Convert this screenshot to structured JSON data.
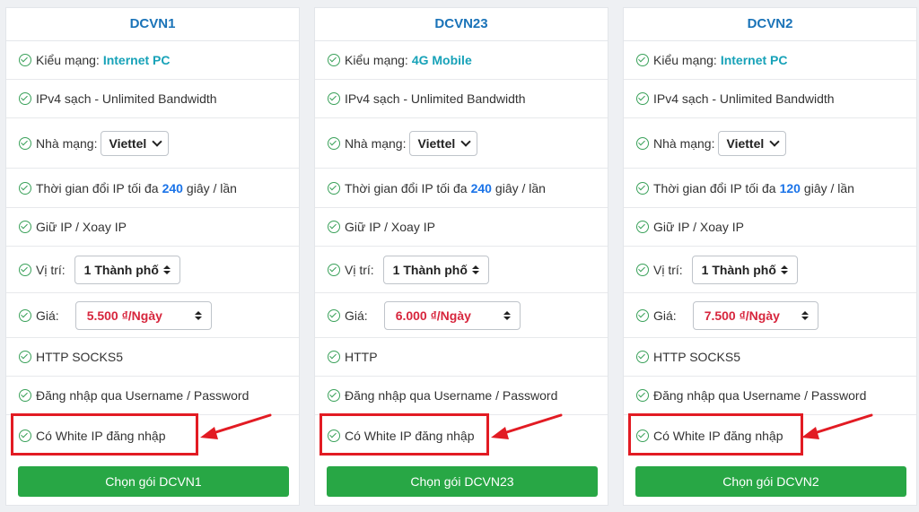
{
  "accent": {
    "green": "#28a745",
    "red_highlight": "#e21b23",
    "title_blue": "#1a73b8"
  },
  "icons": {
    "check": "check-circle-icon",
    "arrow": "red-arrow-annotation"
  },
  "plans": [
    {
      "title": "DCVN1",
      "network_label": "Kiểu mạng:",
      "network_value": "Internet PC",
      "ipv4": "IPv4 sạch - Unlimited Bandwidth",
      "isp_label": "Nhà mạng:",
      "isp_value": "Viettel",
      "rotate_prefix": "Thời gian đổi IP tối đa",
      "rotate_seconds": "240",
      "rotate_suffix": "giây / lần",
      "keep_ip": "Giữ IP / Xoay IP",
      "location_label": "Vị trí:",
      "location_value": "1 Thành phố",
      "price_label": "Giá:",
      "price_value": "5.500 ₫/Ngày",
      "protocols": "HTTP SOCKS5",
      "login": "Đăng nhập qua Username / Password",
      "whitelist": "Có White IP đăng nhập",
      "button": "Chọn gói DCVN1"
    },
    {
      "title": "DCVN23",
      "network_label": "Kiểu mạng:",
      "network_value": "4G Mobile",
      "ipv4": "IPv4 sạch - Unlimited Bandwidth",
      "isp_label": "Nhà mạng:",
      "isp_value": "Viettel",
      "rotate_prefix": "Thời gian đổi IP tối đa",
      "rotate_seconds": "240",
      "rotate_suffix": "giây / lần",
      "keep_ip": "Giữ IP / Xoay IP",
      "location_label": "Vị trí:",
      "location_value": "1 Thành phố",
      "price_label": "Giá:",
      "price_value": "6.000 ₫/Ngày",
      "protocols": "HTTP",
      "login": "Đăng nhập qua Username / Password",
      "whitelist": "Có White IP đăng nhập",
      "button": "Chọn gói DCVN23"
    },
    {
      "title": "DCVN2",
      "network_label": "Kiểu mạng:",
      "network_value": "Internet PC",
      "ipv4": "IPv4 sạch - Unlimited Bandwidth",
      "isp_label": "Nhà mạng:",
      "isp_value": "Viettel",
      "rotate_prefix": "Thời gian đổi IP tối đa",
      "rotate_seconds": "120",
      "rotate_suffix": "giây / lần",
      "keep_ip": "Giữ IP / Xoay IP",
      "location_label": "Vị trí:",
      "location_value": "1 Thành phố",
      "price_label": "Giá:",
      "price_value": "7.500 ₫/Ngày",
      "protocols": "HTTP SOCKS5",
      "login": "Đăng nhập qua Username / Password",
      "whitelist": "Có White IP đăng nhập",
      "button": "Chọn gói DCVN2"
    }
  ]
}
